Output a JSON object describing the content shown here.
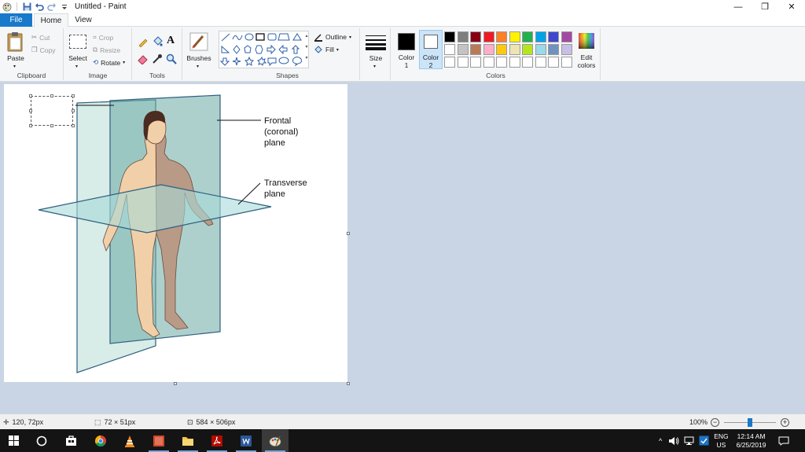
{
  "window": {
    "title": "Untitled - Paint",
    "minimize_glyph": "—",
    "restore_glyph": "❐",
    "close_glyph": "✕"
  },
  "tabs": {
    "file": "File",
    "home": "Home",
    "view": "View"
  },
  "ribbon": {
    "clipboard": {
      "group_label": "Clipboard",
      "paste": "Paste",
      "cut": "Cut",
      "copy": "Copy"
    },
    "image": {
      "group_label": "Image",
      "select": "Select",
      "crop": "Crop",
      "resize": "Resize",
      "rotate": "Rotate"
    },
    "tools": {
      "group_label": "Tools"
    },
    "brushes": {
      "label": "Brushes"
    },
    "shapes": {
      "group_label": "Shapes",
      "outline": "Outline",
      "fill": "Fill"
    },
    "size": {
      "label": "Size"
    },
    "colors": {
      "group_label": "Colors",
      "color1_label": "Color\n1",
      "color2_label": "Color\n2",
      "color1_value": "#000000",
      "color2_value": "#ffffff",
      "edit_colors": "Edit\ncolors",
      "palette_row1": [
        "#000000",
        "#7f7f7f",
        "#880015",
        "#ed1c24",
        "#ff7f27",
        "#fff200",
        "#22b14c",
        "#00a2e8",
        "#3f48cc",
        "#a349a4"
      ],
      "palette_row2": [
        "#ffffff",
        "#c3c3c3",
        "#b97a57",
        "#ffaec9",
        "#ffc90e",
        "#efe4b0",
        "#b5e61d",
        "#99d9ea",
        "#7092be",
        "#c8bfe7"
      ],
      "palette_row3": [
        "#ffffff",
        "#ffffff",
        "#ffffff",
        "#ffffff",
        "#ffffff",
        "#ffffff",
        "#ffffff",
        "#ffffff",
        "#ffffff",
        "#ffffff"
      ]
    }
  },
  "figure": {
    "frontal_label": [
      "Frontal",
      "(coronal)",
      "plane"
    ],
    "transverse_label": [
      "Transverse",
      "plane"
    ]
  },
  "status": {
    "cursor_pos": "120, 72px",
    "selection_size": "72 × 51px",
    "image_size": "584 × 506px",
    "zoom": "100%"
  },
  "taskbar": {
    "lang_primary": "ENG",
    "lang_secondary": "US",
    "time": "12:14 AM",
    "date": "6/25/2019"
  }
}
